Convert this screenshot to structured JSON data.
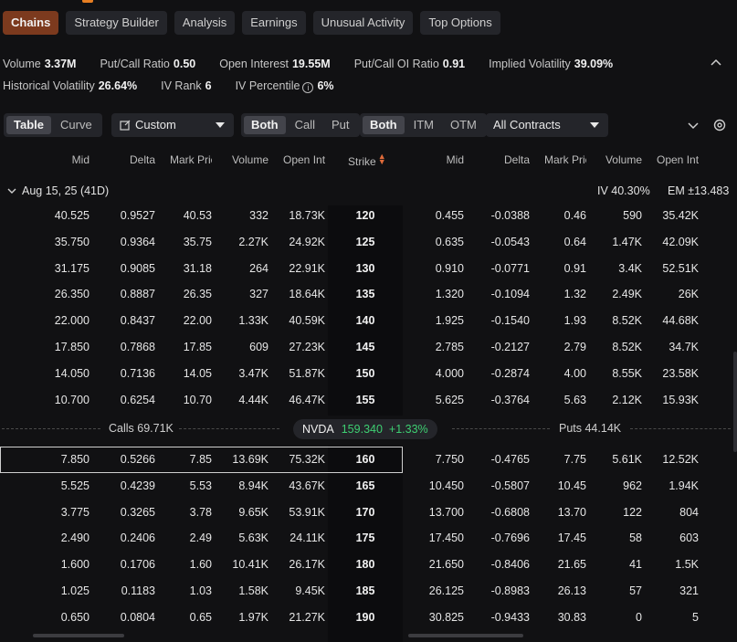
{
  "nav": {
    "tabs": [
      "Chains",
      "Strategy Builder",
      "Analysis",
      "Earnings",
      "Unusual Activity",
      "Top Options"
    ],
    "active": "Chains"
  },
  "stats": {
    "volume_label": "Volume",
    "volume": "3.37M",
    "pcr_label": "Put/Call Ratio",
    "pcr": "0.50",
    "oi_label": "Open Interest",
    "oi": "19.55M",
    "pcoi_label": "Put/Call OI Ratio",
    "pcoi": "0.91",
    "iv_label": "Implied Volatility",
    "iv": "39.09%",
    "hv_label": "Historical Volatility",
    "hv": "26.64%",
    "ivr_label": "IV Rank",
    "ivr": "6",
    "ivp_label": "IV Percentile",
    "ivp": "6%"
  },
  "toolbar": {
    "view": [
      "Table",
      "Curve"
    ],
    "custom": "Custom",
    "type": [
      "Both",
      "Call",
      "Put"
    ],
    "money": [
      "Both",
      "ITM",
      "OTM"
    ],
    "contracts": "All Contracts"
  },
  "headers": {
    "calls": [
      "Mid",
      "Delta",
      "Mark Price",
      "Volume",
      "Open Interest"
    ],
    "strike": "Strike",
    "puts": [
      "Mid",
      "Delta",
      "Mark Price",
      "Volume",
      "Open Interest"
    ]
  },
  "expiry": {
    "label": "Aug 15, 25 (41D)",
    "iv": "IV 40.30%",
    "em": "EM ±13.483"
  },
  "midbar": {
    "calls": "Calls 69.71K",
    "ticker": "NVDA",
    "price": "159.340",
    "change": "+1.33%",
    "puts": "Puts 44.14K"
  },
  "rows_itm": [
    {
      "c": [
        "40.525",
        "0.9527",
        "40.53",
        "332",
        "18.73K"
      ],
      "s": "120",
      "p": [
        "0.455",
        "-0.0388",
        "0.46",
        "590",
        "35.42K"
      ]
    },
    {
      "c": [
        "35.750",
        "0.9364",
        "35.75",
        "2.27K",
        "24.92K"
      ],
      "s": "125",
      "p": [
        "0.635",
        "-0.0543",
        "0.64",
        "1.47K",
        "42.09K"
      ]
    },
    {
      "c": [
        "31.175",
        "0.9085",
        "31.18",
        "264",
        "22.91K"
      ],
      "s": "130",
      "p": [
        "0.910",
        "-0.0771",
        "0.91",
        "3.4K",
        "52.51K"
      ]
    },
    {
      "c": [
        "26.350",
        "0.8887",
        "26.35",
        "327",
        "18.64K"
      ],
      "s": "135",
      "p": [
        "1.320",
        "-0.1094",
        "1.32",
        "2.49K",
        "26K"
      ]
    },
    {
      "c": [
        "22.000",
        "0.8437",
        "22.00",
        "1.33K",
        "40.59K"
      ],
      "s": "140",
      "p": [
        "1.925",
        "-0.1540",
        "1.93",
        "8.52K",
        "44.68K"
      ]
    },
    {
      "c": [
        "17.850",
        "0.7868",
        "17.85",
        "609",
        "27.23K"
      ],
      "s": "145",
      "p": [
        "2.785",
        "-0.2127",
        "2.79",
        "8.52K",
        "34.7K"
      ]
    },
    {
      "c": [
        "14.050",
        "0.7136",
        "14.05",
        "3.47K",
        "51.87K"
      ],
      "s": "150",
      "p": [
        "4.000",
        "-0.2874",
        "4.00",
        "8.55K",
        "23.58K"
      ]
    },
    {
      "c": [
        "10.700",
        "0.6254",
        "10.70",
        "4.44K",
        "46.47K"
      ],
      "s": "155",
      "p": [
        "5.625",
        "-0.3764",
        "5.63",
        "2.12K",
        "15.93K"
      ]
    }
  ],
  "rows_otm": [
    {
      "c": [
        "7.850",
        "0.5266",
        "7.85",
        "13.69K",
        "75.32K"
      ],
      "s": "160",
      "p": [
        "7.750",
        "-0.4765",
        "7.75",
        "5.61K",
        "12.52K"
      ]
    },
    {
      "c": [
        "5.525",
        "0.4239",
        "5.53",
        "8.94K",
        "43.67K"
      ],
      "s": "165",
      "p": [
        "10.450",
        "-0.5807",
        "10.45",
        "962",
        "1.94K"
      ]
    },
    {
      "c": [
        "3.775",
        "0.3265",
        "3.78",
        "9.65K",
        "53.91K"
      ],
      "s": "170",
      "p": [
        "13.700",
        "-0.6808",
        "13.70",
        "122",
        "804"
      ]
    },
    {
      "c": [
        "2.490",
        "0.2406",
        "2.49",
        "5.63K",
        "24.11K"
      ],
      "s": "175",
      "p": [
        "17.450",
        "-0.7696",
        "17.45",
        "58",
        "603"
      ]
    },
    {
      "c": [
        "1.600",
        "0.1706",
        "1.60",
        "10.41K",
        "26.17K"
      ],
      "s": "180",
      "p": [
        "21.650",
        "-0.8406",
        "21.65",
        "41",
        "1.5K"
      ]
    },
    {
      "c": [
        "1.025",
        "0.1183",
        "1.03",
        "1.58K",
        "9.45K"
      ],
      "s": "185",
      "p": [
        "26.125",
        "-0.8983",
        "26.13",
        "57",
        "321"
      ]
    },
    {
      "c": [
        "0.650",
        "0.0804",
        "0.65",
        "1.97K",
        "21.27K"
      ],
      "s": "190",
      "p": [
        "30.825",
        "-0.9433",
        "30.83",
        "0",
        "5"
      ]
    }
  ]
}
